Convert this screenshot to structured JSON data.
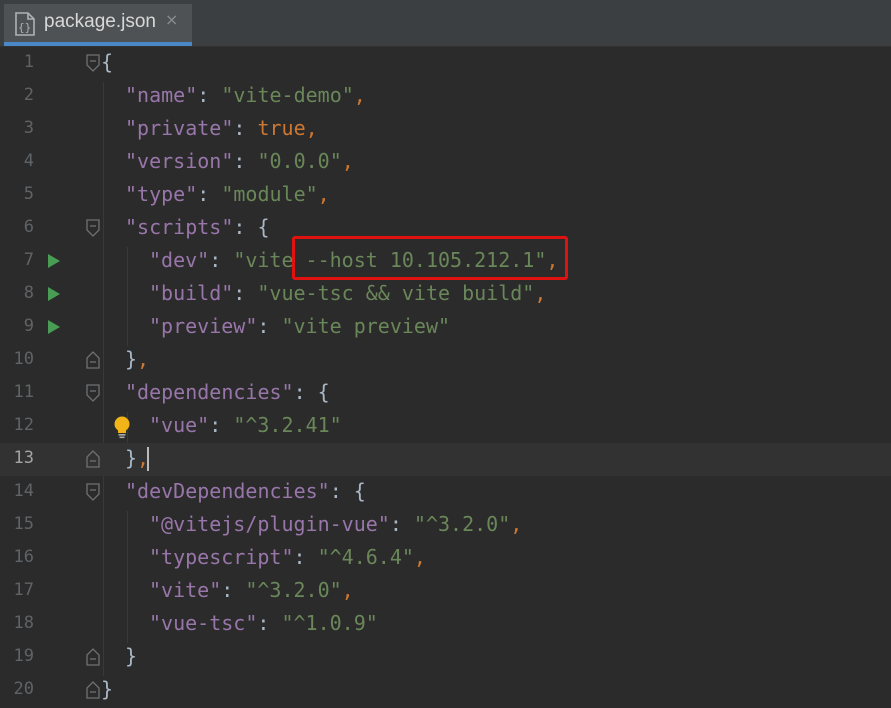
{
  "tab": {
    "title": "package.json",
    "close_glyph": "×",
    "icon": "json-file-icon"
  },
  "editor": {
    "current_line": 13,
    "lines": [
      {
        "number": "1",
        "tokens": [
          {
            "t": "t",
            "v": "{"
          }
        ]
      },
      {
        "number": "2",
        "tokens": [
          {
            "t": "k",
            "v": "\"name\""
          },
          {
            "t": "t",
            "v": ": "
          },
          {
            "t": "s",
            "v": "\"vite-demo\""
          },
          {
            "t": "p",
            "v": ","
          }
        ]
      },
      {
        "number": "3",
        "tokens": [
          {
            "t": "k",
            "v": "\"private\""
          },
          {
            "t": "t",
            "v": ": "
          },
          {
            "t": "b",
            "v": "true"
          },
          {
            "t": "p",
            "v": ","
          }
        ]
      },
      {
        "number": "4",
        "tokens": [
          {
            "t": "k",
            "v": "\"version\""
          },
          {
            "t": "t",
            "v": ": "
          },
          {
            "t": "s",
            "v": "\"0.0.0\""
          },
          {
            "t": "p",
            "v": ","
          }
        ]
      },
      {
        "number": "5",
        "tokens": [
          {
            "t": "k",
            "v": "\"type\""
          },
          {
            "t": "t",
            "v": ": "
          },
          {
            "t": "s",
            "v": "\"module\""
          },
          {
            "t": "p",
            "v": ","
          }
        ]
      },
      {
        "number": "6",
        "tokens": [
          {
            "t": "k",
            "v": "\"scripts\""
          },
          {
            "t": "t",
            "v": ": {"
          }
        ]
      },
      {
        "number": "7",
        "tokens": [
          {
            "t": "k",
            "v": "\"dev\""
          },
          {
            "t": "t",
            "v": ": "
          },
          {
            "t": "s",
            "v": "\"vite --host 10.105.212.1\""
          },
          {
            "t": "p",
            "v": ","
          }
        ]
      },
      {
        "number": "8",
        "tokens": [
          {
            "t": "k",
            "v": "\"build\""
          },
          {
            "t": "t",
            "v": ": "
          },
          {
            "t": "s",
            "v": "\"vue-tsc && vite build\""
          },
          {
            "t": "p",
            "v": ","
          }
        ]
      },
      {
        "number": "9",
        "tokens": [
          {
            "t": "k",
            "v": "\"preview\""
          },
          {
            "t": "t",
            "v": ": "
          },
          {
            "t": "s",
            "v": "\"vite preview\""
          }
        ]
      },
      {
        "number": "10",
        "tokens": [
          {
            "t": "t",
            "v": "}"
          },
          {
            "t": "p",
            "v": ","
          }
        ]
      },
      {
        "number": "11",
        "tokens": [
          {
            "t": "k",
            "v": "\"dependencies\""
          },
          {
            "t": "t",
            "v": ": {"
          }
        ]
      },
      {
        "number": "12",
        "tokens": [
          {
            "t": "k",
            "v": "\"vue\""
          },
          {
            "t": "t",
            "v": ": "
          },
          {
            "t": "s",
            "v": "\"^3.2.41\""
          }
        ]
      },
      {
        "number": "13",
        "tokens": [
          {
            "t": "t",
            "v": "}"
          },
          {
            "t": "p",
            "v": ","
          }
        ]
      },
      {
        "number": "14",
        "tokens": [
          {
            "t": "k",
            "v": "\"devDependencies\""
          },
          {
            "t": "t",
            "v": ": {"
          }
        ]
      },
      {
        "number": "15",
        "tokens": [
          {
            "t": "k",
            "v": "\"@vitejs/plugin-vue\""
          },
          {
            "t": "t",
            "v": ": "
          },
          {
            "t": "s",
            "v": "\"^3.2.0\""
          },
          {
            "t": "p",
            "v": ","
          }
        ]
      },
      {
        "number": "16",
        "tokens": [
          {
            "t": "k",
            "v": "\"typescript\""
          },
          {
            "t": "t",
            "v": ": "
          },
          {
            "t": "s",
            "v": "\"^4.6.4\""
          },
          {
            "t": "p",
            "v": ","
          }
        ]
      },
      {
        "number": "17",
        "tokens": [
          {
            "t": "k",
            "v": "\"vite\""
          },
          {
            "t": "t",
            "v": ": "
          },
          {
            "t": "s",
            "v": "\"^3.2.0\""
          },
          {
            "t": "p",
            "v": ","
          }
        ]
      },
      {
        "number": "18",
        "tokens": [
          {
            "t": "k",
            "v": "\"vue-tsc\""
          },
          {
            "t": "t",
            "v": ": "
          },
          {
            "t": "s",
            "v": "\"^1.0.9\""
          }
        ]
      },
      {
        "number": "19",
        "tokens": [
          {
            "t": "t",
            "v": "}"
          }
        ]
      },
      {
        "number": "20",
        "tokens": [
          {
            "t": "t",
            "v": "}"
          }
        ]
      }
    ]
  },
  "colors": {
    "background": "#2b2b2b",
    "key": "#9876aa",
    "string": "#6a8759",
    "keyword": "#cc7832",
    "run": "#499c54",
    "highlight": "#e0120f"
  }
}
